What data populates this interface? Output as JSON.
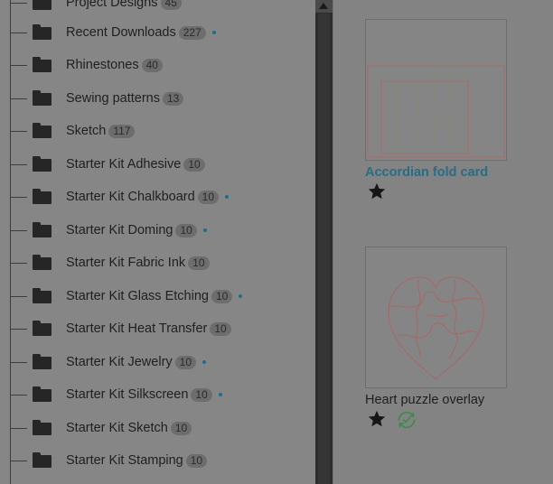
{
  "folders": [
    {
      "label": "Project Designs",
      "count": "45",
      "dot": false
    },
    {
      "label": "Recent Downloads",
      "count": "227",
      "dot": true
    },
    {
      "label": "Rhinestones",
      "count": "40",
      "dot": false
    },
    {
      "label": "Sewing patterns",
      "count": "13",
      "dot": false
    },
    {
      "label": "Sketch",
      "count": "117",
      "dot": false
    },
    {
      "label": "Starter Kit Adhesive",
      "count": "10",
      "dot": false
    },
    {
      "label": "Starter Kit Chalkboard",
      "count": "10",
      "dot": true
    },
    {
      "label": "Starter Kit Doming",
      "count": "10",
      "dot": true
    },
    {
      "label": "Starter Kit Fabric Ink",
      "count": "10",
      "dot": false
    },
    {
      "label": "Starter Kit Glass Etching",
      "count": "10",
      "dot": true
    },
    {
      "label": "Starter Kit Heat Transfer",
      "count": "10",
      "dot": false
    },
    {
      "label": "Starter Kit Jewelry",
      "count": "10",
      "dot": true
    },
    {
      "label": "Starter Kit Silkscreen",
      "count": "10",
      "dot": true
    },
    {
      "label": "Starter Kit Sketch",
      "count": "10",
      "dot": false
    },
    {
      "label": "Starter Kit Stamping",
      "count": "10",
      "dot": false
    }
  ],
  "projects": [
    {
      "title": "Accordian fold card",
      "icon": "star-icon",
      "status_icon": "synced-icon"
    },
    {
      "title": "Heart puzzle overlay",
      "icon": "star-icon",
      "status_icon": "synced-icon"
    }
  ],
  "colors": {
    "accent": "#2a6c86",
    "synced": "#3d8a4d",
    "dot": "#1c6e8a",
    "line_art": "#a56a6a"
  }
}
